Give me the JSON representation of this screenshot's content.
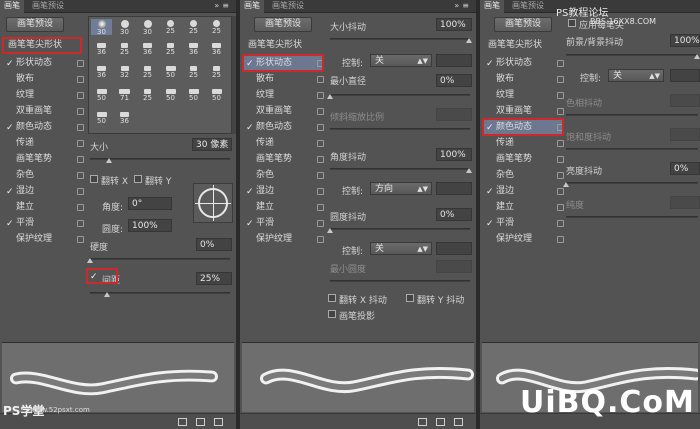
{
  "tabs": {
    "brush": "画笔",
    "presets": "画笔预设",
    "menu_icon": "double-chevron-menu-icon"
  },
  "preset_button": "画笔预设",
  "brush_items": [
    {
      "label": "画笔笔尖形状",
      "checked": false
    },
    {
      "label": "形状动态",
      "checked": true
    },
    {
      "label": "散布",
      "checked": false
    },
    {
      "label": "纹理",
      "checked": false
    },
    {
      "label": "双重画笔",
      "checked": false
    },
    {
      "label": "颜色动态",
      "checked": true
    },
    {
      "label": "传递",
      "checked": false
    },
    {
      "label": "画笔笔势",
      "checked": false
    },
    {
      "label": "杂色",
      "checked": false
    },
    {
      "label": "湿边",
      "checked": true
    },
    {
      "label": "建立",
      "checked": false
    },
    {
      "label": "平滑",
      "checked": true
    },
    {
      "label": "保护纹理",
      "checked": false
    }
  ],
  "tip_grid": [
    "30",
    "30",
    "30",
    "25",
    "25",
    "25",
    "36",
    "25",
    "36",
    "25",
    "36",
    "36",
    "36",
    "32",
    "25",
    "50",
    "25",
    "25",
    "50",
    "71",
    "25",
    "50",
    "50",
    "50",
    "50",
    "36"
  ],
  "panel1": {
    "size_label": "大小",
    "size_value": "30 像素",
    "flip_x": "翻转 X",
    "flip_y": "翻转 Y",
    "angle_label": "角度:",
    "angle_value": "0°",
    "roundness_label": "圆度:",
    "roundness_value": "100%",
    "hardness_label": "硬度",
    "hardness_value": "0%",
    "spacing_label": "间距",
    "spacing_value": "25%"
  },
  "panel2": {
    "size_jitter_label": "大小抖动",
    "size_jitter_value": "100%",
    "control_label": "控制:",
    "control1_value": "关",
    "min_diameter_label": "最小直径",
    "min_diameter_value": "0%",
    "tilt_scale_label": "倾斜缩放比例",
    "angle_jitter_label": "角度抖动",
    "angle_jitter_value": "100%",
    "control2_value": "方向",
    "roundness_jitter_label": "圆度抖动",
    "roundness_jitter_value": "0%",
    "control3_value": "关",
    "min_roundness_label": "最小圆度",
    "flip_x_jitter": "翻转 X 抖动",
    "flip_y_jitter": "翻转 Y 抖动",
    "brush_projection": "画笔投影"
  },
  "panel3": {
    "apply_per_tip": "应用每笔尖",
    "fg_bg_jitter_label": "前景/背景抖动",
    "fg_bg_jitter_value": "100%",
    "control_label": "控制:",
    "control_value": "关",
    "hue_jitter_label": "色相抖动",
    "saturation_jitter_label": "饱和度抖动",
    "brightness_jitter_label": "亮度抖动",
    "brightness_jitter_value": "0%",
    "purity_label": "纯度"
  },
  "watermarks": {
    "top_right": "PS教程论坛",
    "top_right_sub": "BBS.16XX8.COM",
    "bottom_right": "UiBQ.CoM",
    "bottom_left": "PS学堂",
    "bottom_left_sub": "www.52psxt.com"
  },
  "accent": {
    "highlight": "#6d7890",
    "red_box": "#cc2a2a"
  }
}
